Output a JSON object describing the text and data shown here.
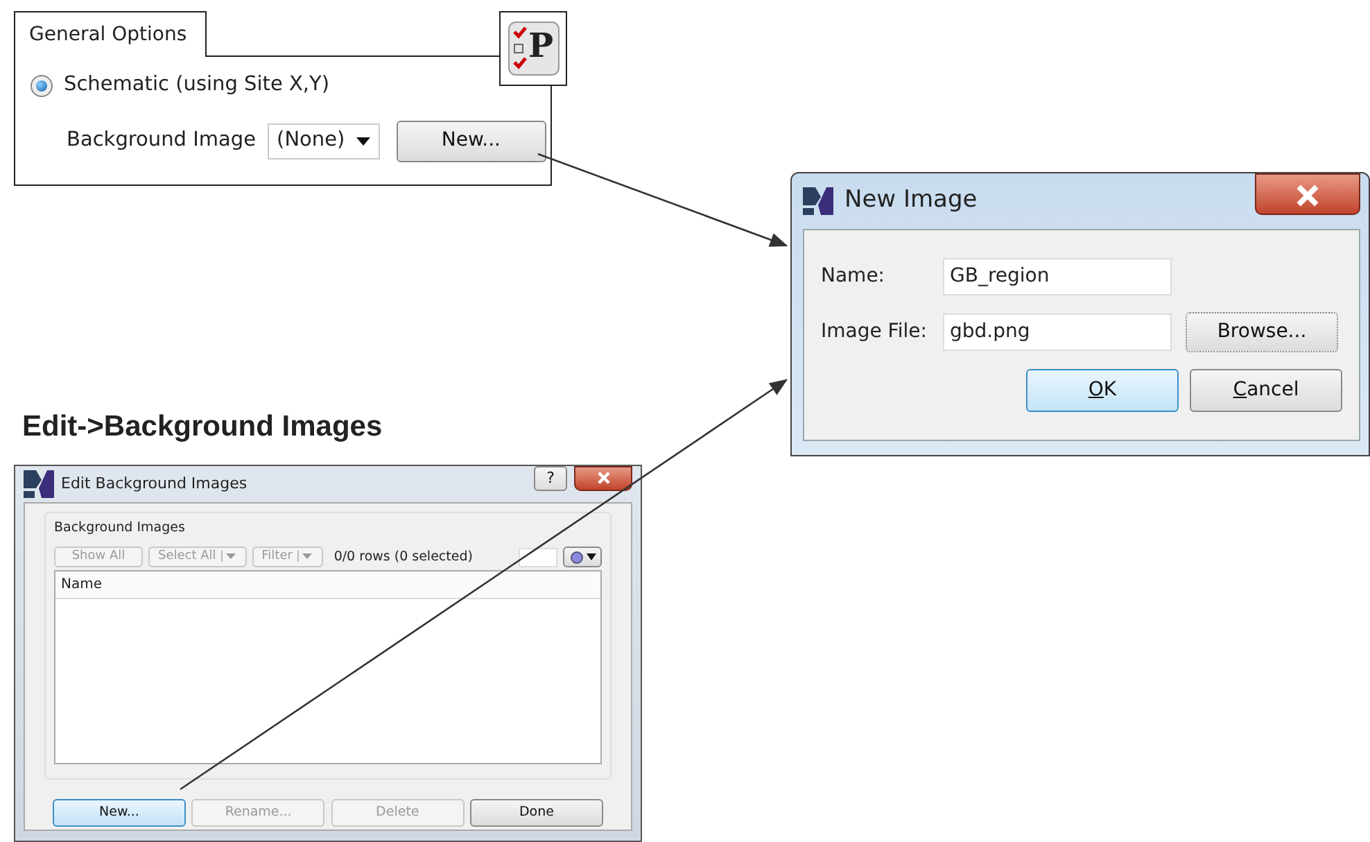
{
  "general_options": {
    "tab": "General Options",
    "radio": {
      "label": "Schematic (using Site X,Y)",
      "checked": true
    },
    "background_image": {
      "label": "Background Image",
      "value": "(None)"
    },
    "new_button": "New...",
    "icon_letter": "P"
  },
  "new_image_dialog": {
    "title": "New Image",
    "fields": [
      {
        "label": "Name:",
        "value": "GB_region"
      },
      {
        "label": "Image File:",
        "value": "gbd.png"
      }
    ],
    "browse_button": "Browse...",
    "buttons": [
      {
        "accel": "O",
        "rest": "K",
        "default": true
      },
      {
        "accel": "C",
        "rest": "ancel",
        "default": false
      }
    ]
  },
  "heading": "Edit->Background Images",
  "edit_dialog": {
    "title": "Edit Background Images",
    "help_button": "?",
    "group": "Background Images",
    "toolbar": [
      {
        "kind": "button",
        "label": "Show All",
        "disabled": true
      },
      {
        "kind": "split",
        "label": "Select All",
        "disabled": true
      },
      {
        "kind": "split",
        "label": "Filter",
        "disabled": true
      }
    ],
    "row_count": "0/0 rows (0 selected)",
    "columns": [
      "Name"
    ],
    "buttons": [
      {
        "label": "New...",
        "disabled": false,
        "default": true
      },
      {
        "label": "Rename...",
        "disabled": true,
        "default": false
      },
      {
        "label": "Delete",
        "disabled": true,
        "default": false
      },
      {
        "label": "Done",
        "disabled": false,
        "default": false
      }
    ]
  }
}
